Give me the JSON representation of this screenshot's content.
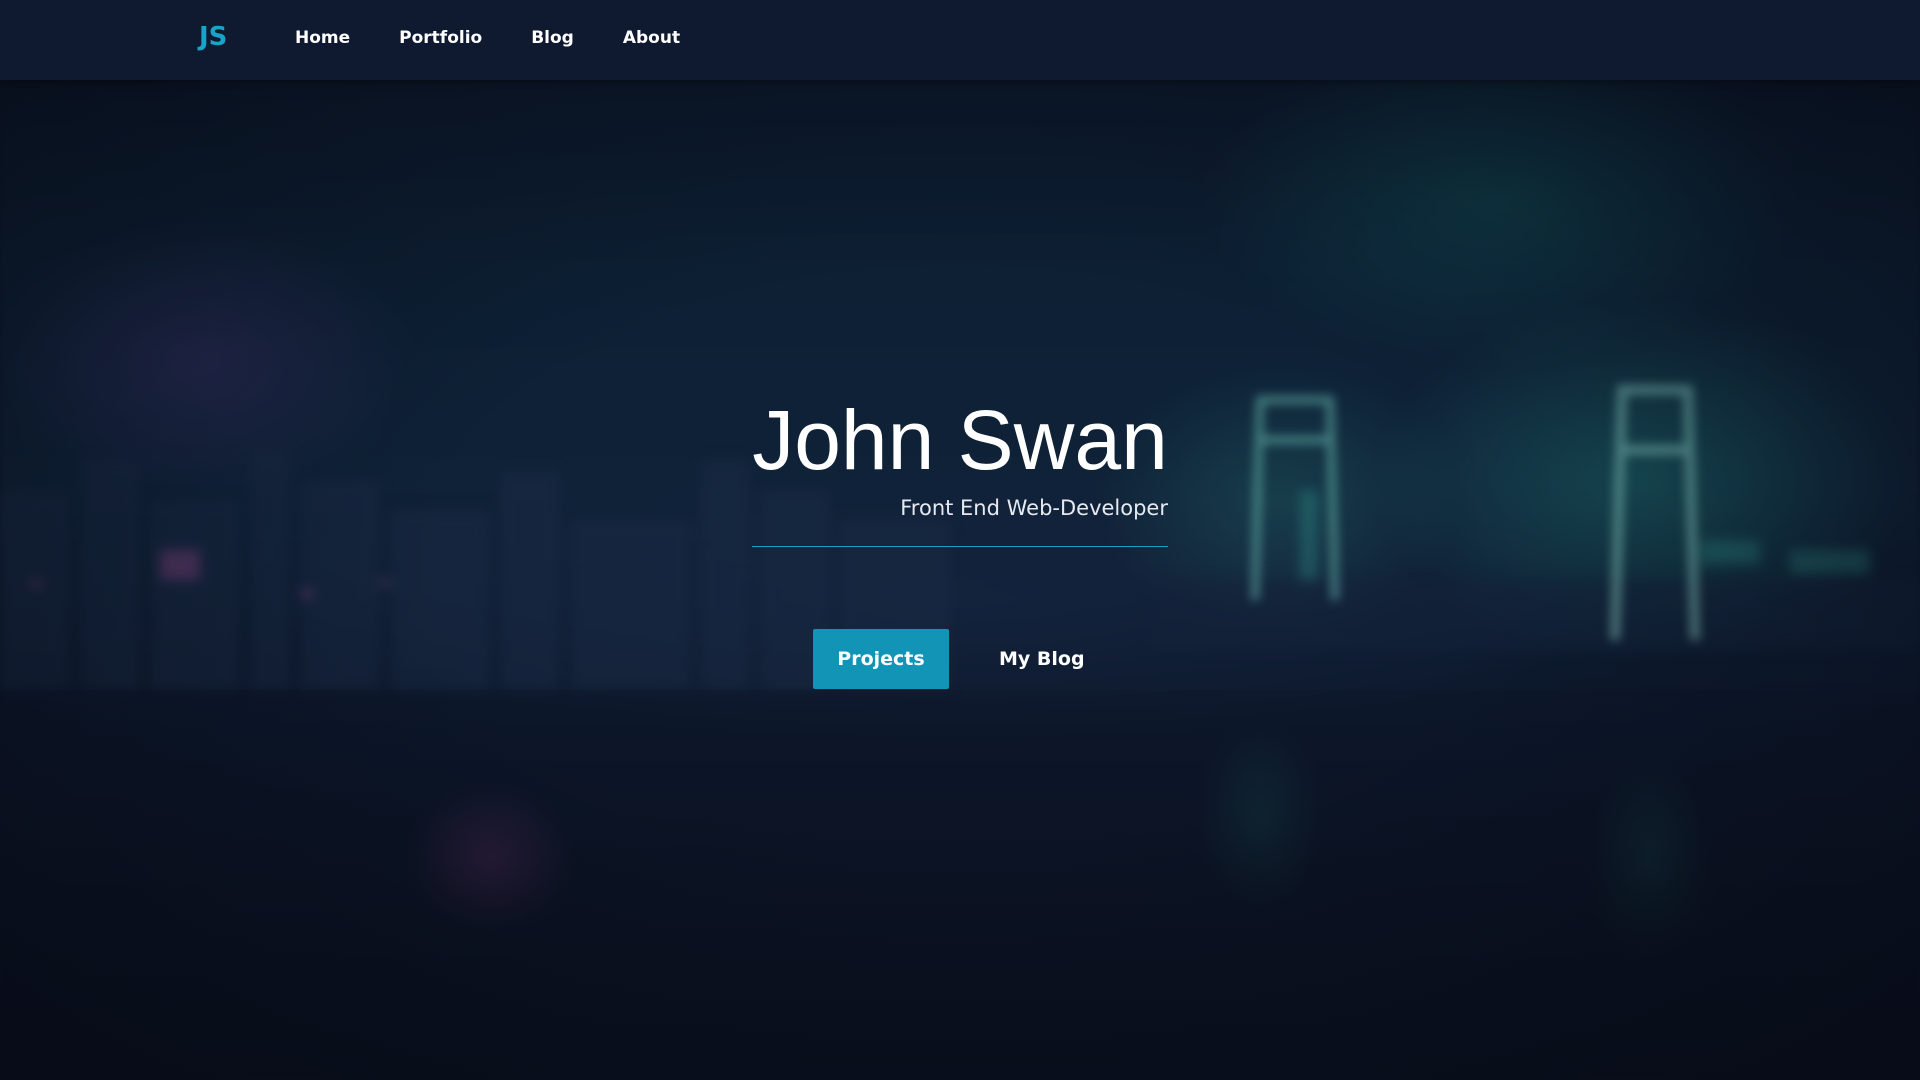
{
  "navbar": {
    "brand": "JS",
    "links": [
      {
        "label": "Home"
      },
      {
        "label": "Portfolio"
      },
      {
        "label": "Blog"
      },
      {
        "label": "About"
      }
    ]
  },
  "hero": {
    "name": "John Swan",
    "subtitle": "Front End Web-Developer",
    "primary_button": "Projects",
    "secondary_button": "My Blog"
  },
  "colors": {
    "accent": "#1194b6",
    "brand": "#1aa3c8",
    "navbar_bg": "#0f1930",
    "divider": "#1c9fbf"
  },
  "background": {
    "description_icon": "blurred-night-city-photo"
  }
}
